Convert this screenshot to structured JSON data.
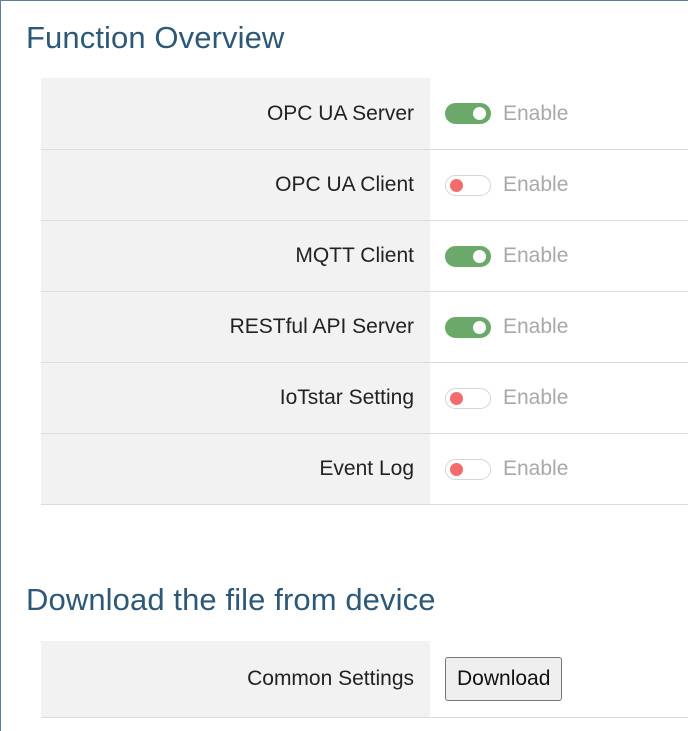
{
  "function_overview": {
    "title": "Function Overview",
    "rows": [
      {
        "label": "OPC UA Server",
        "enabled": true,
        "toggle_label": "Enable"
      },
      {
        "label": "OPC UA Client",
        "enabled": false,
        "toggle_label": "Enable"
      },
      {
        "label": "MQTT Client",
        "enabled": true,
        "toggle_label": "Enable"
      },
      {
        "label": "RESTful API Server",
        "enabled": true,
        "toggle_label": "Enable"
      },
      {
        "label": "IoTstar Setting",
        "enabled": false,
        "toggle_label": "Enable"
      },
      {
        "label": "Event Log",
        "enabled": false,
        "toggle_label": "Enable"
      }
    ]
  },
  "download": {
    "title": "Download the file from device",
    "rows": [
      {
        "label": "Common Settings",
        "button_label": "Download"
      }
    ]
  },
  "colors": {
    "heading": "#2d5878",
    "toggle_on": "#6aa96a",
    "toggle_off_knob": "#f46b6b",
    "label_cell_bg": "#f2f2f2"
  }
}
